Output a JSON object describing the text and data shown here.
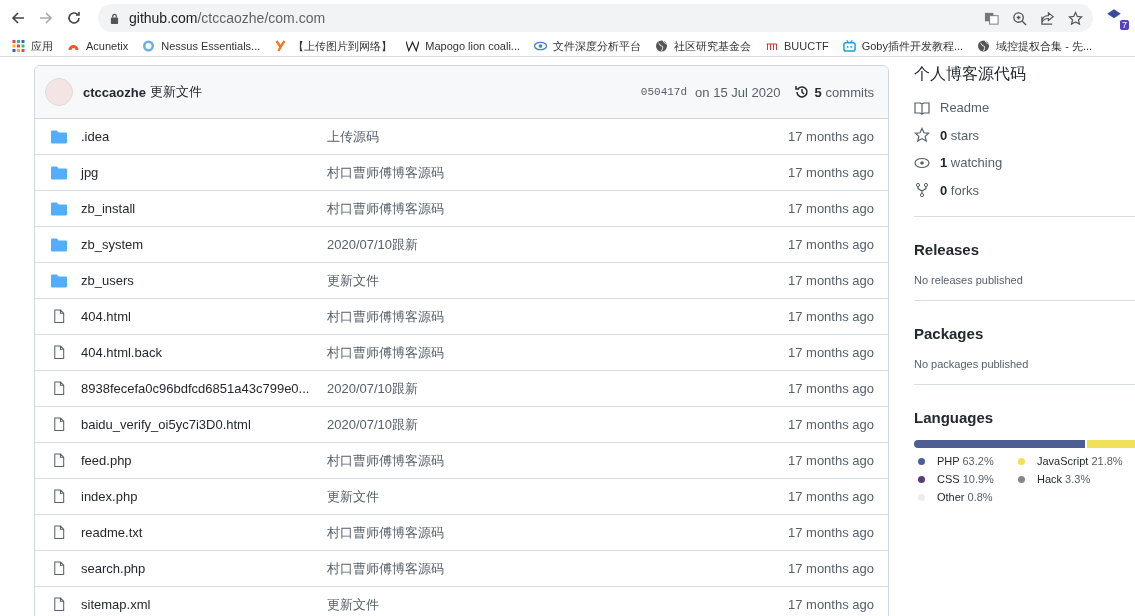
{
  "browser": {
    "url_host": "github.com",
    "url_path": "/ctccaozhe/com.com",
    "extension_badge": "7"
  },
  "bookmarks": [
    {
      "label": "应用",
      "kind": "apps"
    },
    {
      "label": "Acunetix",
      "kind": "acunetix"
    },
    {
      "label": "Nessus Essentials...",
      "kind": "nessus"
    },
    {
      "label": "【上传图片到网络】",
      "kind": "y"
    },
    {
      "label": "Mapogo lion coali...",
      "kind": "w"
    },
    {
      "label": "文件深度分析平台",
      "kind": "eye"
    },
    {
      "label": "社区研究基金会",
      "kind": "globe"
    },
    {
      "label": "BUUCTF",
      "kind": "buu"
    },
    {
      "label": "Goby插件开发教程...",
      "kind": "tv"
    },
    {
      "label": "域控提权合集 - 先...",
      "kind": "globe"
    }
  ],
  "commit": {
    "author": "ctccaozhe",
    "message": "更新文件",
    "hash": "050417d",
    "date": "on 15 Jul 2020",
    "count": "5",
    "count_label": "commits"
  },
  "files": [
    {
      "name": ".idea",
      "kind": "dir",
      "message": "上传源码",
      "age": "17 months ago"
    },
    {
      "name": "jpg",
      "kind": "dir",
      "message": "村口曹师傅博客源码",
      "age": "17 months ago"
    },
    {
      "name": "zb_install",
      "kind": "dir",
      "message": "村口曹师傅博客源码",
      "age": "17 months ago"
    },
    {
      "name": "zb_system",
      "kind": "dir",
      "message": "2020/07/10跟新",
      "age": "17 months ago"
    },
    {
      "name": "zb_users",
      "kind": "dir",
      "message": "更新文件",
      "age": "17 months ago"
    },
    {
      "name": "404.html",
      "kind": "file",
      "message": "村口曹师傅博客源码",
      "age": "17 months ago"
    },
    {
      "name": "404.html.back",
      "kind": "file",
      "message": "村口曹师傅博客源码",
      "age": "17 months ago"
    },
    {
      "name": "8938fecefa0c96bdfcd6851a43c799e0...",
      "kind": "file",
      "message": "2020/07/10跟新",
      "age": "17 months ago"
    },
    {
      "name": "baidu_verify_oi5yc7i3D0.html",
      "kind": "file",
      "message": "2020/07/10跟新",
      "age": "17 months ago"
    },
    {
      "name": "feed.php",
      "kind": "file",
      "message": "村口曹师傅博客源码",
      "age": "17 months ago"
    },
    {
      "name": "index.php",
      "kind": "file",
      "message": "更新文件",
      "age": "17 months ago"
    },
    {
      "name": "readme.txt",
      "kind": "file",
      "message": "村口曹师傅博客源码",
      "age": "17 months ago"
    },
    {
      "name": "search.php",
      "kind": "file",
      "message": "村口曹师傅博客源码",
      "age": "17 months ago"
    },
    {
      "name": "sitemap.xml",
      "kind": "file",
      "message": "更新文件",
      "age": "17 months ago"
    }
  ],
  "about": {
    "description": "个人博客源代码",
    "stats": [
      {
        "kind": "book",
        "label": "Readme"
      },
      {
        "kind": "star",
        "count": "0",
        "label": "stars"
      },
      {
        "kind": "eye",
        "count": "1",
        "label": "watching"
      },
      {
        "kind": "fork",
        "count": "0",
        "label": "forks"
      }
    ]
  },
  "releases": {
    "title": "Releases",
    "note": "No releases published"
  },
  "packages": {
    "title": "Packages",
    "note": "No packages published"
  },
  "languages": {
    "title": "Languages",
    "items": [
      {
        "name": "PHP",
        "percent": "63.2%",
        "color": "#4f5d95"
      },
      {
        "name": "JavaScript",
        "percent": "21.8%",
        "color": "#f1e05a"
      },
      {
        "name": "CSS",
        "percent": "10.9%",
        "color": "#563d7c"
      },
      {
        "name": "Hack",
        "percent": "3.3%",
        "color": "#878787"
      },
      {
        "name": "Other",
        "percent": "0.8%",
        "color": "#ededed"
      }
    ]
  }
}
